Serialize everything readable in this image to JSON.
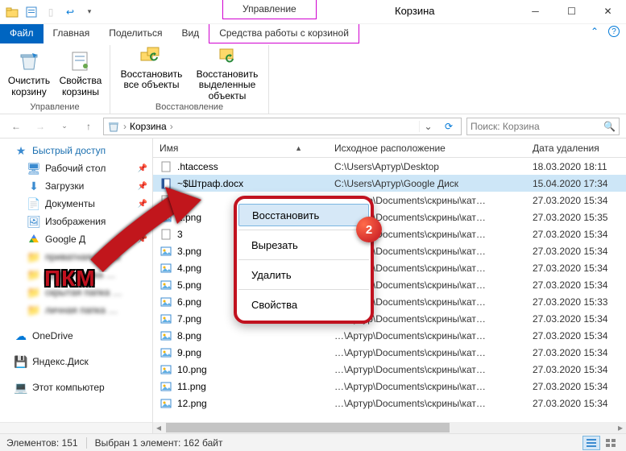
{
  "window": {
    "title": "Корзина",
    "mgmt_tab": "Управление"
  },
  "tabs": {
    "file": "Файл",
    "home": "Главная",
    "share": "Поделиться",
    "view": "Вид",
    "tool": "Средства работы с корзиной"
  },
  "ribbon": {
    "empty": "Очистить корзину",
    "props": "Свойства корзины",
    "restore_all": "Восстановить все объекты",
    "restore_sel": "Восстановить выделенные объекты",
    "group_manage": "Управление",
    "group_restore": "Восстановление"
  },
  "address": {
    "location": "Корзина",
    "sep": "›",
    "search_placeholder": "Поиск: Корзина"
  },
  "nav": {
    "quick": "Быстрый доступ",
    "desktop": "Рабочий стол",
    "downloads": "Загрузки",
    "documents": "Документы",
    "pictures": "Изображения",
    "gdrive": "Google Д",
    "onedrive": "OneDrive",
    "yandex": "Яндекс.Диск",
    "thispc": "Этот компьютер"
  },
  "columns": {
    "name": "Имя",
    "location": "Исходное расположение",
    "deleted": "Дата удаления"
  },
  "files": [
    {
      "name": ".htaccess",
      "loc": "C:\\Users\\Артур\\Desktop",
      "date": "18.03.2020 18:11",
      "icon": "file"
    },
    {
      "name": "~$Штраф.docx",
      "loc": "C:\\Users\\Артур\\Google Диск",
      "date": "15.04.2020 17:34",
      "icon": "doc",
      "selected": true
    },
    {
      "name": "2",
      "loc": "…\\Артур\\Documents\\скрины\\кат…",
      "date": "27.03.2020 15:34",
      "icon": "file"
    },
    {
      "name": "2.png",
      "loc": "…\\Артур\\Documents\\скрины\\кат…",
      "date": "27.03.2020 15:35",
      "icon": "img"
    },
    {
      "name": "3",
      "loc": "…\\Артур\\Documents\\скрины\\кат…",
      "date": "27.03.2020 15:34",
      "icon": "file"
    },
    {
      "name": "3.png",
      "loc": "…\\Артур\\Documents\\скрины\\кат…",
      "date": "27.03.2020 15:34",
      "icon": "img"
    },
    {
      "name": "4.png",
      "loc": "…\\Артур\\Documents\\скрины\\кат…",
      "date": "27.03.2020 15:34",
      "icon": "img"
    },
    {
      "name": "5.png",
      "loc": "…\\Артур\\Documents\\скрины\\кат…",
      "date": "27.03.2020 15:34",
      "icon": "img"
    },
    {
      "name": "6.png",
      "loc": "…\\Артур\\Documents\\скрины\\кат…",
      "date": "27.03.2020 15:33",
      "icon": "img"
    },
    {
      "name": "7.png",
      "loc": "…\\Артур\\Documents\\скрины\\кат…",
      "date": "27.03.2020 15:34",
      "icon": "img"
    },
    {
      "name": "8.png",
      "loc": "…\\Артур\\Documents\\скрины\\кат…",
      "date": "27.03.2020 15:34",
      "icon": "img"
    },
    {
      "name": "9.png",
      "loc": "…\\Артур\\Documents\\скрины\\кат…",
      "date": "27.03.2020 15:34",
      "icon": "img"
    },
    {
      "name": "10.png",
      "loc": "…\\Артур\\Documents\\скрины\\кат…",
      "date": "27.03.2020 15:34",
      "icon": "img"
    },
    {
      "name": "11.png",
      "loc": "…\\Артур\\Documents\\скрины\\кат…",
      "date": "27.03.2020 15:34",
      "icon": "img"
    },
    {
      "name": "12.png",
      "loc": "…\\Артур\\Documents\\скрины\\кат…",
      "date": "27.03.2020 15:34",
      "icon": "img"
    }
  ],
  "context_menu": {
    "restore": "Восстановить",
    "cut": "Вырезать",
    "delete": "Удалить",
    "properties": "Свойства",
    "badge": "2"
  },
  "overlay": {
    "pkm": "ПКМ"
  },
  "status": {
    "count": "Элементов: 151",
    "selection": "Выбран 1 элемент: 162 байт"
  }
}
